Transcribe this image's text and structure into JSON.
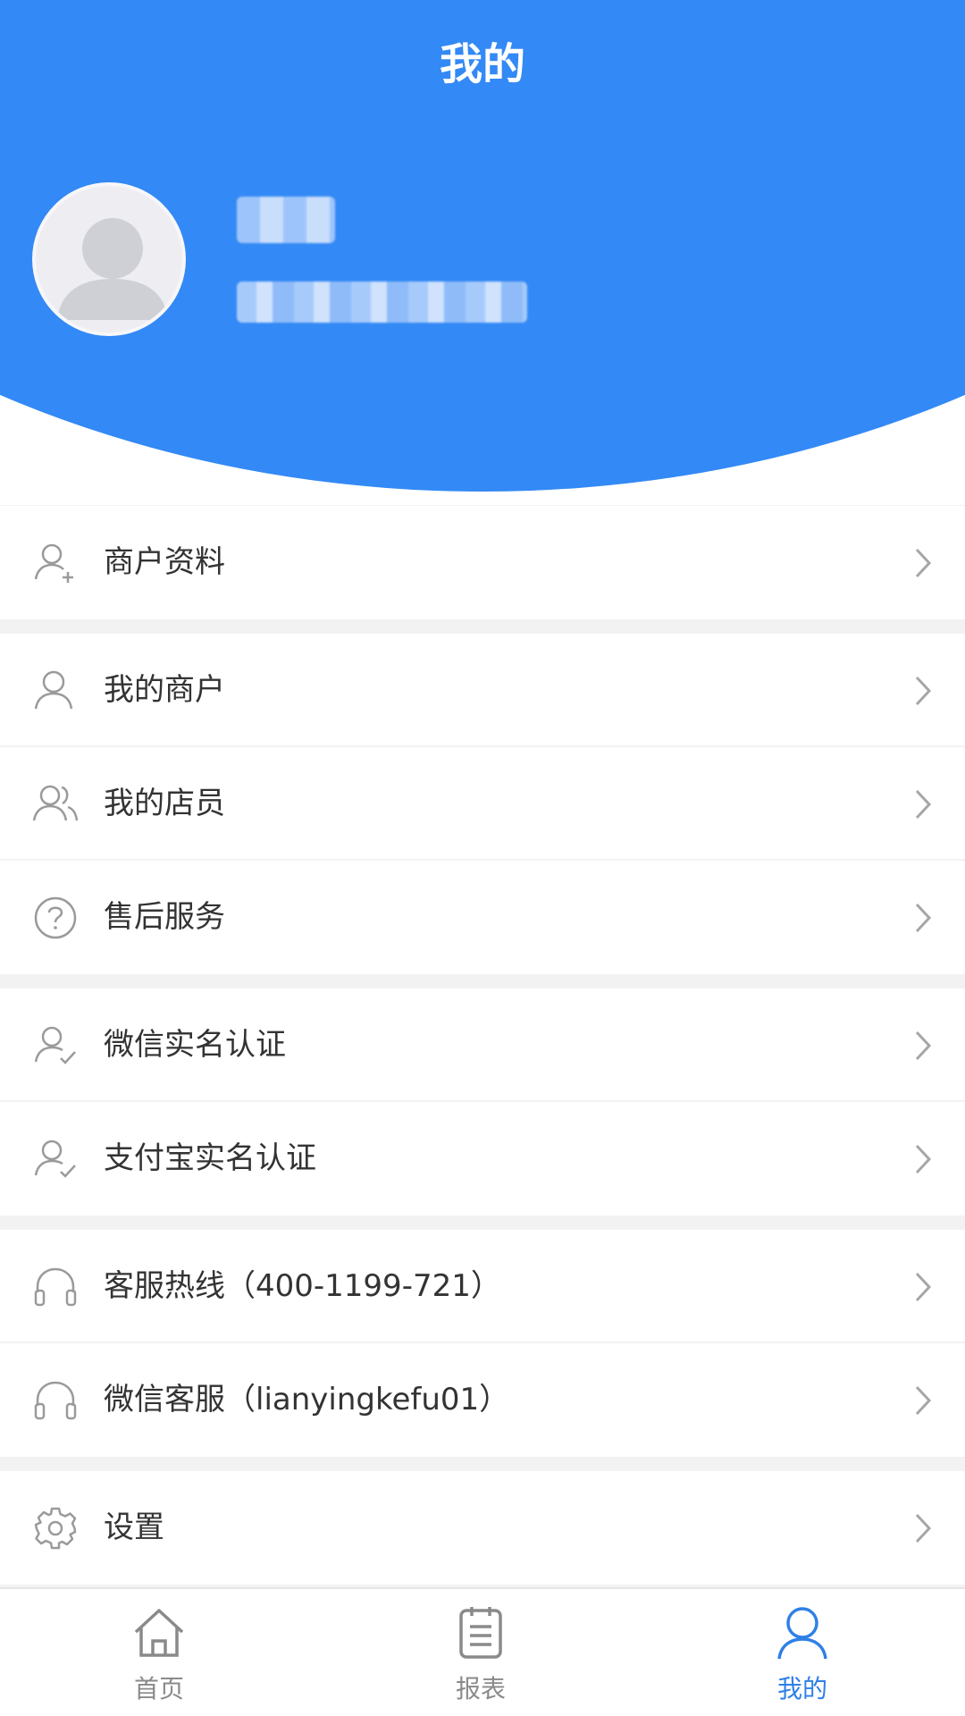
{
  "header": {
    "title": "我的"
  },
  "menu": {
    "groups": [
      {
        "items": [
          {
            "label": "商户资料",
            "icon": "user-add-icon"
          }
        ]
      },
      {
        "items": [
          {
            "label": "我的商户",
            "icon": "user-icon"
          },
          {
            "label": "我的店员",
            "icon": "users-icon"
          },
          {
            "label": "售后服务",
            "icon": "help-circle-icon"
          }
        ]
      },
      {
        "items": [
          {
            "label": "微信实名认证",
            "icon": "user-check-icon"
          },
          {
            "label": "支付宝实名认证",
            "icon": "user-check-icon"
          }
        ]
      },
      {
        "items": [
          {
            "label": "客服热线（400-1199-721）",
            "icon": "headphones-icon"
          },
          {
            "label": "微信客服（lianyingkefu01）",
            "icon": "headphones-icon"
          }
        ]
      },
      {
        "items": [
          {
            "label": "设置",
            "icon": "gear-icon"
          }
        ]
      }
    ]
  },
  "tabbar": {
    "tabs": [
      {
        "label": "首页",
        "icon": "home-icon",
        "active": false
      },
      {
        "label": "报表",
        "icon": "report-icon",
        "active": false
      },
      {
        "label": "我的",
        "icon": "profile-icon",
        "active": true
      }
    ]
  },
  "colors": {
    "primary": "#3389f5",
    "active_tab": "#2f80e6",
    "icon_gray": "#9a9a9a"
  }
}
